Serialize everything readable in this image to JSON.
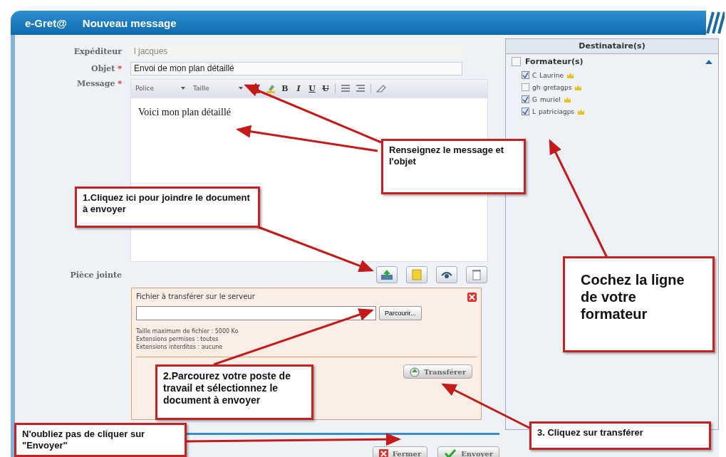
{
  "header": {
    "brand": "e-Gret@",
    "title": "Nouveau message"
  },
  "form": {
    "sender_label": "Expéditeur",
    "sender_value": "l jacques",
    "subject_label": "Objet",
    "subject_value": "Envoi de mon plan détaillé",
    "message_label": "Message",
    "required_mark": "*",
    "selects": [
      "Police",
      "Taille"
    ],
    "format_glyphs": [
      "B",
      "I",
      "U",
      "U"
    ],
    "body": "Voici mon plan détaillé",
    "attachment_label": "Pièce jointe"
  },
  "upload": {
    "title": "Fichier à transférer sur le serveur",
    "browse": "Parcourir...",
    "info": [
      "Taille maximum de fichier : 5000 Ko",
      "Extensions permises : toutes",
      "Extensions interdites : aucune"
    ],
    "transfer": "Transférer"
  },
  "recipients": {
    "title": "Destinataire(s)",
    "group": {
      "label": "Formateur(s)",
      "checked": false,
      "expanded": true
    },
    "items": [
      {
        "prefix": "C",
        "name": "Laurine",
        "checked": true
      },
      {
        "prefix": "gh",
        "name": "gretagps",
        "checked": false
      },
      {
        "prefix": "G",
        "name": "muriel",
        "checked": true
      },
      {
        "prefix": "L",
        "name": "patriciagps",
        "checked": true
      }
    ]
  },
  "buttons": [
    "Fermer",
    "Envoyer"
  ],
  "annotations": [
    {
      "text": "Renseignez le message et l'objet"
    },
    {
      "text": "1.Cliquez ici pour joindre le document à envoyer"
    },
    {
      "text": "Cochez la ligne de votre formateur"
    },
    {
      "text": "2.Parcourez votre poste de travail et sélectionnez le document à envoyer"
    },
    {
      "text": "N'oubliez pas de cliquer sur \"Envoyer\""
    },
    {
      "text": "3. Cliquez sur transférer"
    }
  ]
}
